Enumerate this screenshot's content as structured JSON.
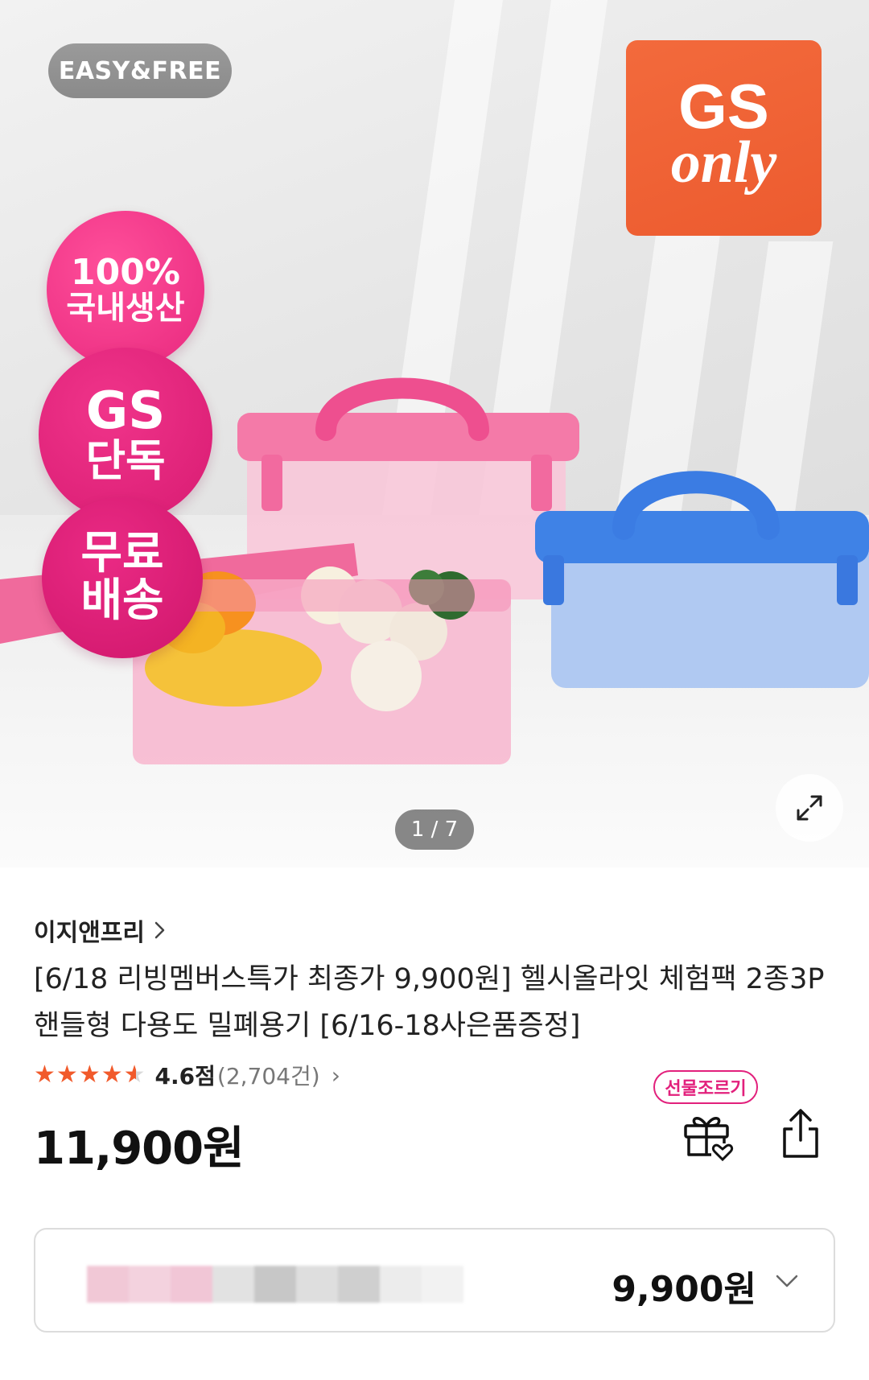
{
  "hero": {
    "brand_logo": "EASY&FREE",
    "gs_only_top": "GS",
    "gs_only_bottom": "only",
    "badges": [
      {
        "line1": "100%",
        "line2": "국내생산"
      },
      {
        "line1": "GS",
        "line2": "단독"
      },
      {
        "line1": "무료",
        "line2": "배송"
      }
    ],
    "counter": "1 / 7",
    "expand_icon": "expand-arrows-icon"
  },
  "product": {
    "brand": "이지앤프리",
    "brand_chevron": "›",
    "title": "[6/18 리빙멤버스특가 최종가 9,900원] 헬시올라잇 체험팩 2종3P 핸들형 다용도 밀폐용기 [6/16-18사은품증정]",
    "rating": 4.6,
    "rating_text": "4.6점",
    "review_count": "(2,704건)",
    "review_chevron": "›",
    "price": "11,900원",
    "gift_badge": "선물조르기",
    "gift_icon": "gift-heart-icon",
    "share_icon": "share-icon"
  },
  "option": {
    "price": "9,900원",
    "chevron_icon": "chevron-down-icon"
  },
  "colors": {
    "accent_orange": "#f15a2b",
    "pink": "#e2207c",
    "gs_orange": "#ef5f32"
  }
}
